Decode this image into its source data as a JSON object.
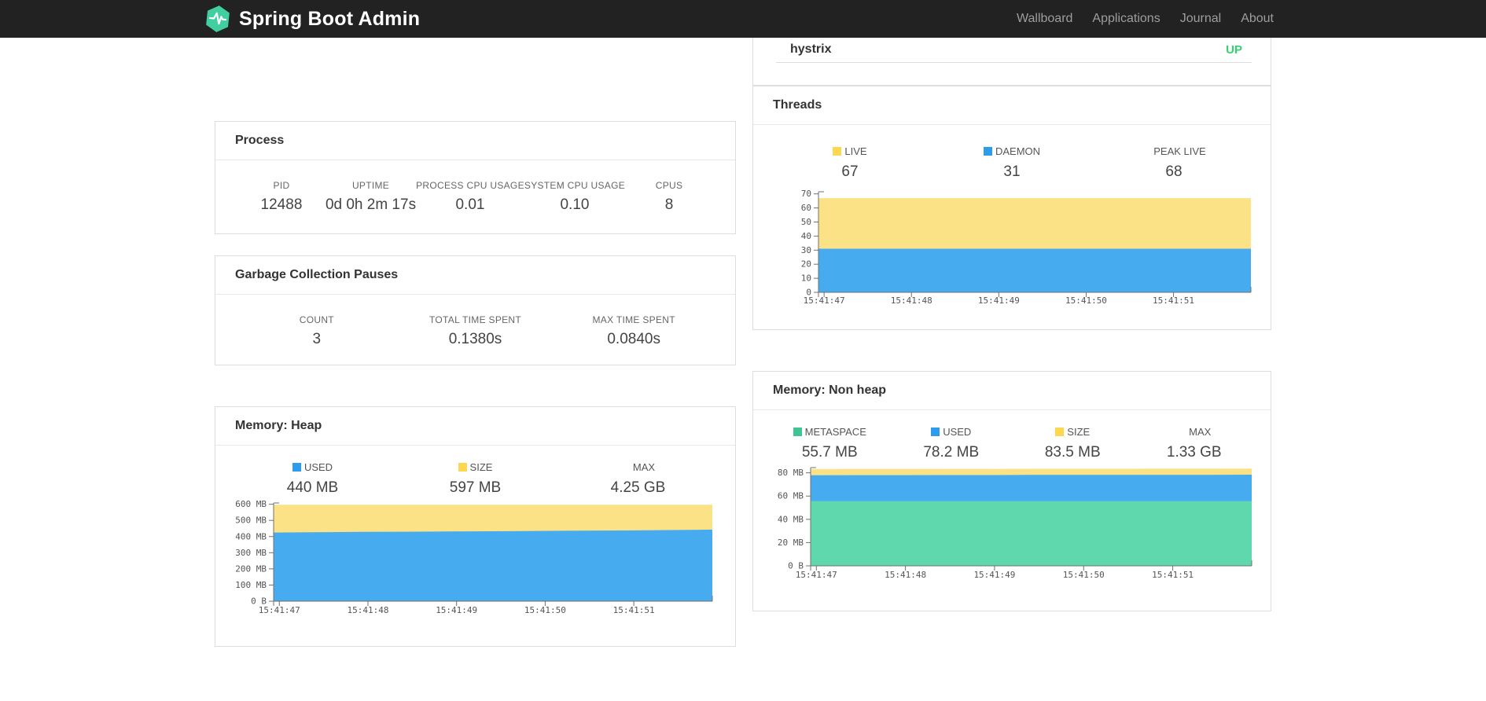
{
  "navbar": {
    "brand": "Spring Boot Admin",
    "brand_color": "#41CFA2",
    "links": [
      {
        "label": "Wallboard"
      },
      {
        "label": "Applications"
      },
      {
        "label": "Journal"
      },
      {
        "label": "About"
      }
    ]
  },
  "colors": {
    "status_up": "#36D16F",
    "area_yellow": "#FCE287",
    "area_blue": "#47ABF0",
    "area_green": "#60D8AE",
    "swatch_yellow": "#FDD750",
    "swatch_blue": "#2D9CEC",
    "swatch_green": "#41C494"
  },
  "applications_card": {
    "rows": [
      {
        "name": "hystrix",
        "status": "UP"
      }
    ]
  },
  "process_card": {
    "title": "Process",
    "stats": [
      {
        "label": "PID",
        "value": "12488"
      },
      {
        "label": "UPTIME",
        "value": "0d 0h 2m 17s"
      },
      {
        "label": "PROCESS CPU USAGE",
        "value": "0.01"
      },
      {
        "label": "SYSTEM CPU USAGE",
        "value": "0.10"
      },
      {
        "label": "CPUS",
        "value": "8"
      }
    ]
  },
  "gc_card": {
    "title": "Garbage Collection Pauses",
    "stats": [
      {
        "label": "COUNT",
        "value": "3"
      },
      {
        "label": "TOTAL TIME SPENT",
        "value": "0.1380s"
      },
      {
        "label": "MAX TIME SPENT",
        "value": "0.0840s"
      }
    ]
  },
  "threads_card": {
    "title": "Threads",
    "legend": [
      {
        "label": "LIVE",
        "value": "67",
        "color": "#FDD750"
      },
      {
        "label": "DAEMON",
        "value": "31",
        "color": "#2D9CEC"
      },
      {
        "label": "PEAK LIVE",
        "value": "68",
        "color": null
      }
    ]
  },
  "heap_card": {
    "title": "Memory: Heap",
    "legend": [
      {
        "label": "USED",
        "value": "440 MB",
        "color": "#2D9CEC"
      },
      {
        "label": "SIZE",
        "value": "597 MB",
        "color": "#FDD750"
      },
      {
        "label": "MAX",
        "value": "4.25 GB",
        "color": null
      }
    ]
  },
  "nonheap_card": {
    "title": "Memory: Non heap",
    "legend": [
      {
        "label": "METASPACE",
        "value": "55.7 MB",
        "color": "#41C494"
      },
      {
        "label": "USED",
        "value": "78.2 MB",
        "color": "#2D9CEC"
      },
      {
        "label": "SIZE",
        "value": "83.5 MB",
        "color": "#FDD750"
      },
      {
        "label": "MAX",
        "value": "1.33 GB",
        "color": null
      }
    ]
  },
  "chart_data": [
    {
      "id": "threads",
      "type": "area",
      "title": "Threads",
      "x": [
        "15:41:47",
        "15:41:48",
        "15:41:49",
        "15:41:50",
        "15:41:51"
      ],
      "xtick_fracs": [
        0.013,
        0.215,
        0.417,
        0.619,
        0.821
      ],
      "ylim": [
        0,
        71.5
      ],
      "yticks": [
        {
          "v": 0,
          "label": "0"
        },
        {
          "v": 10,
          "label": "10"
        },
        {
          "v": 20,
          "label": "20"
        },
        {
          "v": 30,
          "label": "30"
        },
        {
          "v": 40,
          "label": "40"
        },
        {
          "v": 50,
          "label": "50"
        },
        {
          "v": 60,
          "label": "60"
        },
        {
          "v": 70,
          "label": "70"
        }
      ],
      "series": [
        {
          "name": "LIVE",
          "color": "#FCE287",
          "values": [
            67,
            67,
            67,
            67,
            67,
            67,
            67,
            67,
            67,
            67,
            67
          ]
        },
        {
          "name": "DAEMON",
          "color": "#47ABF0",
          "values": [
            31,
            31,
            31,
            31,
            31,
            31,
            31,
            31,
            31,
            31,
            31
          ]
        }
      ]
    },
    {
      "id": "heap",
      "type": "area",
      "title": "Memory: Heap",
      "x": [
        "15:41:47",
        "15:41:48",
        "15:41:49",
        "15:41:50",
        "15:41:51"
      ],
      "xtick_fracs": [
        0.013,
        0.215,
        0.417,
        0.619,
        0.821
      ],
      "ylim": [
        0,
        608
      ],
      "yticks": [
        {
          "v": 0,
          "label": "0 B"
        },
        {
          "v": 100,
          "label": "100 MB"
        },
        {
          "v": 200,
          "label": "200 MB"
        },
        {
          "v": 300,
          "label": "300 MB"
        },
        {
          "v": 400,
          "label": "400 MB"
        },
        {
          "v": 500,
          "label": "500 MB"
        },
        {
          "v": 600,
          "label": "600 MB"
        }
      ],
      "series": [
        {
          "name": "SIZE",
          "color": "#FCE287",
          "values": [
            597,
            597,
            597,
            597,
            597,
            597,
            597,
            597,
            597,
            597,
            597
          ]
        },
        {
          "name": "USED",
          "color": "#47ABF0",
          "values": [
            425,
            427,
            429,
            430,
            432,
            433,
            435,
            437,
            438,
            440,
            443
          ]
        }
      ]
    },
    {
      "id": "nonheap",
      "type": "area",
      "title": "Memory: Non heap",
      "x": [
        "15:41:47",
        "15:41:48",
        "15:41:49",
        "15:41:50",
        "15:41:51"
      ],
      "xtick_fracs": [
        0.013,
        0.215,
        0.417,
        0.619,
        0.821
      ],
      "ylim": [
        0,
        84.5
      ],
      "yticks": [
        {
          "v": 0,
          "label": "0 B"
        },
        {
          "v": 20,
          "label": "20 MB"
        },
        {
          "v": 40,
          "label": "40 MB"
        },
        {
          "v": 60,
          "label": "60 MB"
        },
        {
          "v": 80,
          "label": "80 MB"
        }
      ],
      "series": [
        {
          "name": "SIZE",
          "color": "#FCE287",
          "values": [
            83.2,
            83.3,
            83.3,
            83.4,
            83.4,
            83.5,
            83.5,
            83.5,
            83.6,
            83.6,
            83.7
          ]
        },
        {
          "name": "USED",
          "color": "#47ABF0",
          "values": [
            77.9,
            78.0,
            78.0,
            78.1,
            78.1,
            78.2,
            78.2,
            78.2,
            78.3,
            78.3,
            78.4
          ]
        },
        {
          "name": "METASPACE",
          "color": "#60D8AE",
          "values": [
            55.7,
            55.7,
            55.7,
            55.7,
            55.7,
            55.7,
            55.7,
            55.7,
            55.7,
            55.7,
            55.7
          ]
        }
      ]
    }
  ]
}
